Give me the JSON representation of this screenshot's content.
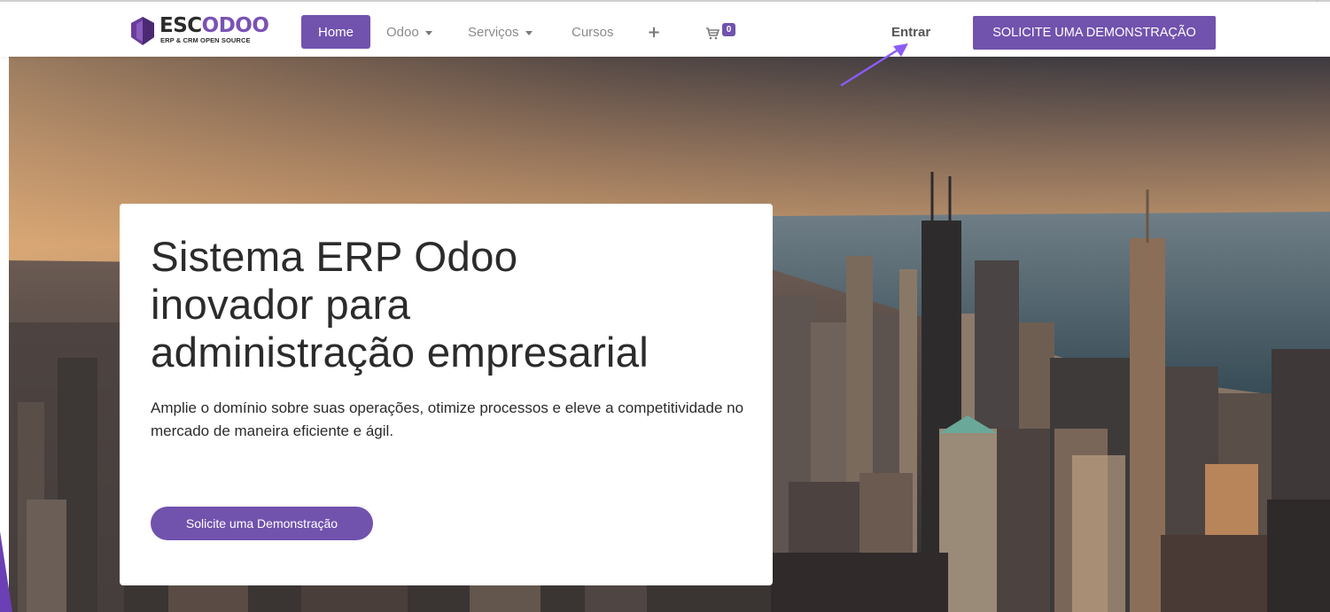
{
  "colors": {
    "accent": "#7152ad",
    "text_dark": "#2b2b2b",
    "nav_text": "#8a8a8a",
    "annotation_arrow": "#8b5cf6"
  },
  "logo": {
    "text_esc": "ESC",
    "text_odoo": "ODOO",
    "subtitle": "ERP & CRM OPEN SOURCE",
    "icon": "shield-logo-icon"
  },
  "nav": {
    "home": "Home",
    "odoo": "Odoo",
    "servicos": "Serviços",
    "cursos": "Cursos",
    "plus_icon": "plus-icon",
    "cart_icon": "shopping-cart-icon",
    "cart_count": "0",
    "login": "Entrar",
    "cta": "SOLICITE UMA DEMONSTRAÇÃO"
  },
  "hero": {
    "title_lines": [
      "Sistema ERP Odoo",
      "inovador para",
      "administração empresarial"
    ],
    "description": "Amplie o domínio sobre suas operações, otimize processos e eleve a competitividade no mercado de maneira eficiente e ágil.",
    "button": "Solicite uma Demonstração",
    "background": "city-skyline-image"
  }
}
